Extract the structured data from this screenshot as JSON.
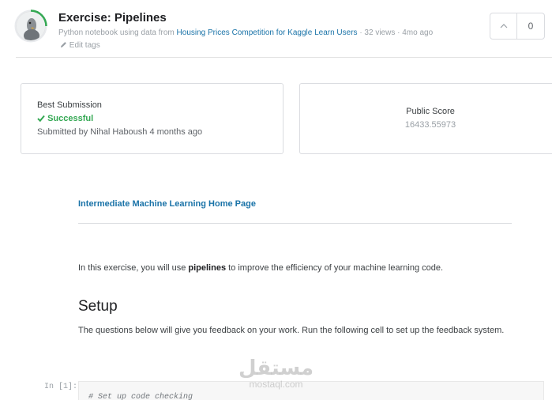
{
  "header": {
    "title": "Exercise: Pipelines",
    "subtitle_prefix": "Python notebook using data from ",
    "dataset_link": "Housing Prices Competition for Kaggle Learn Users",
    "subtitle_suffix": " · 32 views · 4mo ago",
    "edit_tags": "Edit tags",
    "vote_count": "0"
  },
  "best_submission": {
    "label": "Best Submission",
    "status": "Successful",
    "submitted_by": "Submitted by Nihal Haboush 4 months ago"
  },
  "public_score": {
    "label": "Public Score",
    "value": "16433.55973"
  },
  "notebook": {
    "home_link": "Intermediate Machine Learning Home Page",
    "intro_before": "In this exercise, you will use ",
    "intro_bold": "pipelines",
    "intro_after": " to improve the efficiency of your machine learning code.",
    "setup_heading": "Setup",
    "setup_desc": "The questions below will give you feedback on your work. Run the following cell to set up the feedback system.",
    "cell_prompt": "In [1]:",
    "code_comment": "# Set up code checking"
  },
  "watermark": {
    "arabic": "مستقل",
    "latin": "mostaql.com"
  },
  "colors": {
    "accent_link": "#1a73a8",
    "success": "#34a853",
    "progress_ring": "#20beff"
  },
  "icons": {
    "avatar": "avatar-image",
    "success": "check-icon",
    "edit": "pencil-icon",
    "upvote": "chevron-up-icon"
  }
}
